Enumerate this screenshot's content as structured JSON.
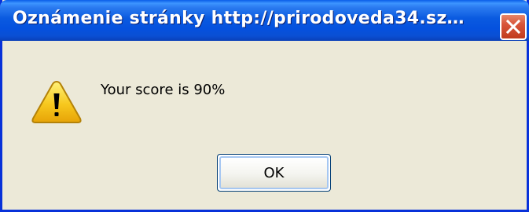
{
  "dialog": {
    "title": "Oznámenie stránky http://prirodoveda34.sz…",
    "message": "Your score is 90%",
    "ok_label": "OK",
    "icon": "warning-icon",
    "close_icon": "close-icon"
  },
  "colors": {
    "titlebar_blue": "#0a5ae0",
    "frame_blue": "#0831d9",
    "dialog_background": "#ece9d8",
    "close_red": "#d8553a",
    "warning_yellow": "#f7c81e"
  }
}
